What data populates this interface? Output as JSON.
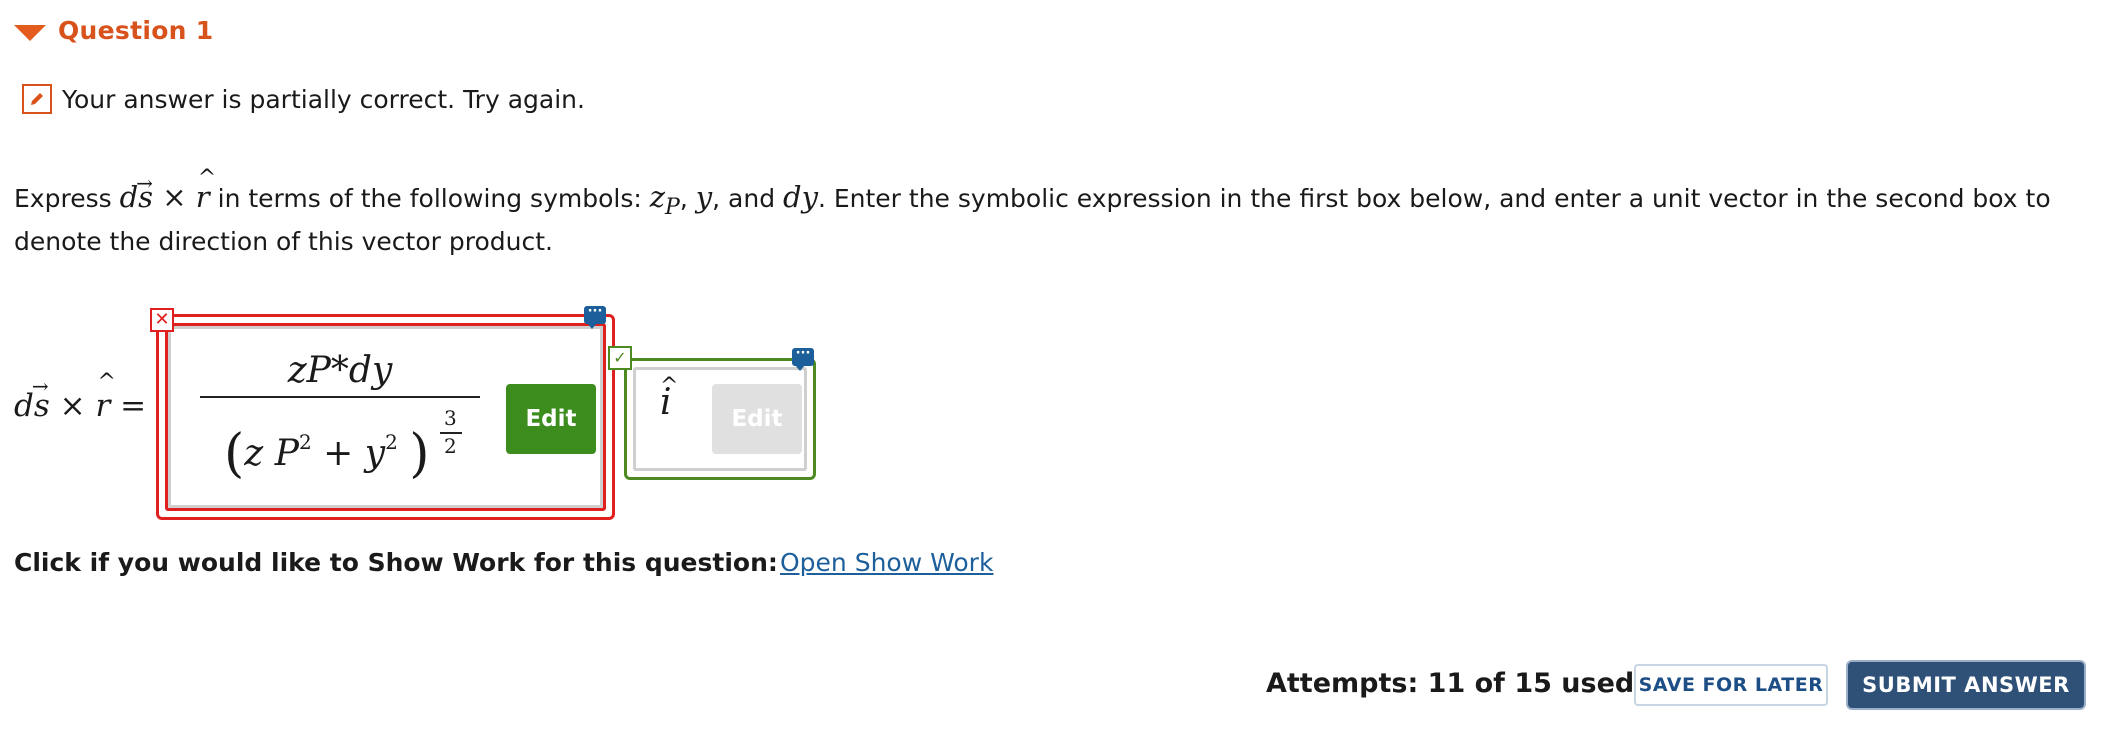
{
  "question": {
    "title": "Question 1",
    "status_text": "Your answer is partially correct.  Try again."
  },
  "prompt": {
    "part1": "Express ",
    "part2": " in terms of the following symbols: ",
    "sym_zp": "z",
    "sym_zp_sub": "P",
    "sep1": ", ",
    "sym_y": "y",
    "sep2": ", and ",
    "sym_dy": "dy",
    "part3": ". Enter the symbolic expression in the first box below, and enter a unit vector in the second box to denote the direction of this vector product.",
    "d": "d",
    "s": "s",
    "times": " × ",
    "r": "r"
  },
  "equation": {
    "lhs_d": "d",
    "lhs_s": "s",
    "lhs_times": " × ",
    "lhs_r": "r",
    "equals": " ="
  },
  "answer1": {
    "numerator": "zP*dy",
    "den_open": "(",
    "den_z": "z",
    "den_P": "P",
    "den_sup1": "2",
    "den_plus": " + ",
    "den_y": "y",
    "den_sup2": "2",
    "den_close": ")",
    "exp_num": "3",
    "exp_den": "2",
    "edit_label": "Edit",
    "status": "incorrect"
  },
  "answer2": {
    "value": "i",
    "edit_label": "Edit",
    "status": "correct"
  },
  "show_work": {
    "label": "Click if you would like to Show Work for this question:",
    "link": "Open Show Work"
  },
  "footer": {
    "attempts": "Attempts: 11 of 15 used",
    "save_label": "SAVE FOR LATER",
    "submit_label": "SUBMIT ANSWER"
  },
  "colors": {
    "accent_orange": "#d8521c",
    "incorrect_red": "#e0201f",
    "correct_green": "#4e8a22",
    "edit_green": "#3c8c1e",
    "link_blue": "#1d5f9b",
    "submit_navy": "#2f5178"
  },
  "icons": {
    "collapse": "triangle-down-icon",
    "partial": "pencil-icon",
    "incorrect": "x-mark-icon",
    "correct": "checkmark-icon",
    "more": "ellipsis-speech-icon"
  }
}
